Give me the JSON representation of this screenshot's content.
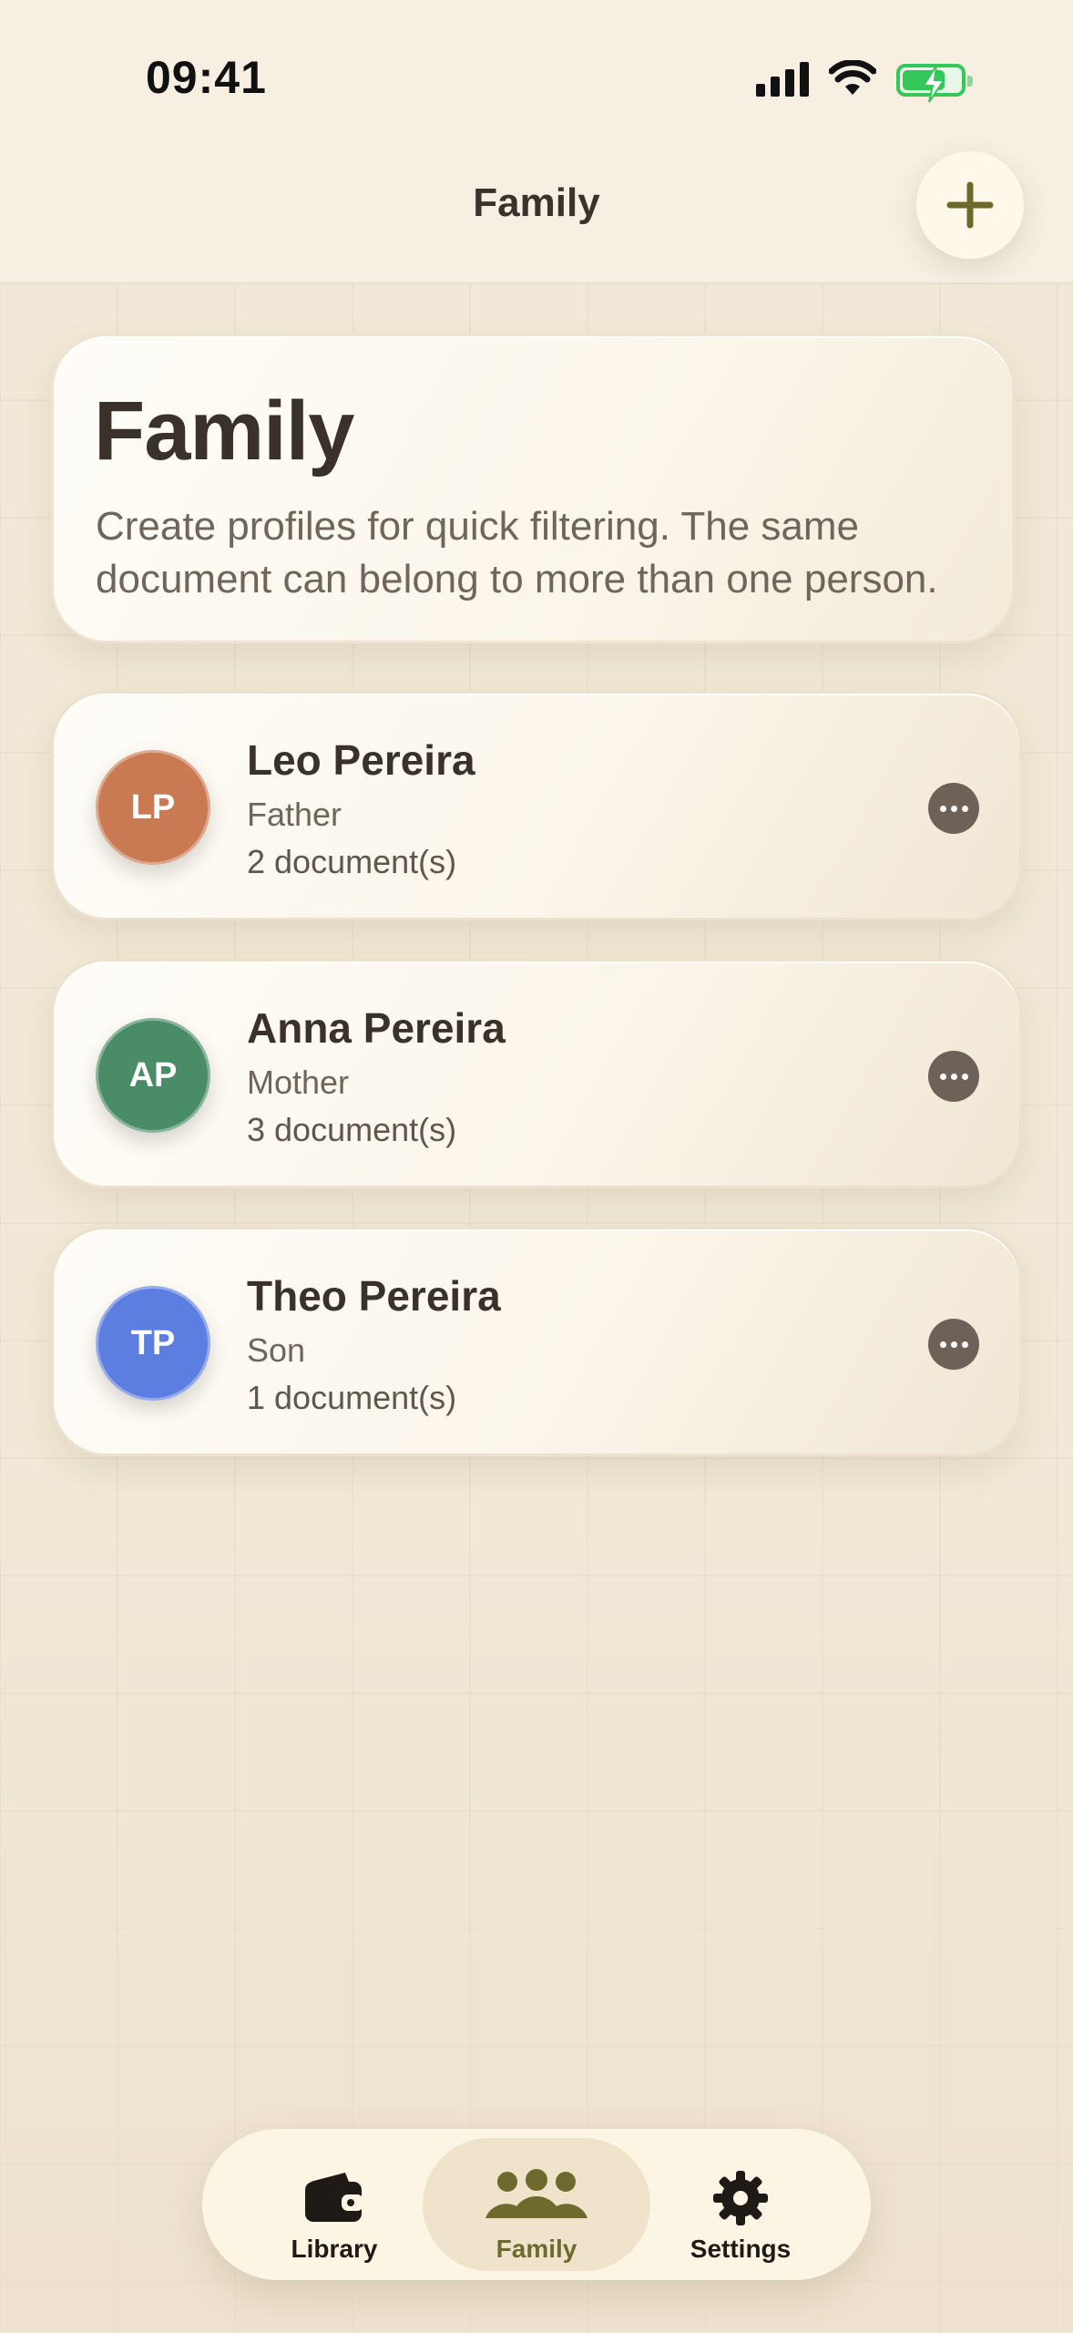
{
  "status_bar": {
    "time": "09:41"
  },
  "nav": {
    "title": "Family",
    "add_label": "+"
  },
  "intro": {
    "title": "Family",
    "subtitle": "Create profiles for quick filtering. The same document can belong to more than one person."
  },
  "members": [
    {
      "initials": "LP",
      "name": "Leo Pereira",
      "role": "Father",
      "documents": "2 document(s)",
      "color": "#c97a52"
    },
    {
      "initials": "AP",
      "name": "Anna Pereira",
      "role": "Mother",
      "documents": "3 document(s)",
      "color": "#4a8c67"
    },
    {
      "initials": "TP",
      "name": "Theo Pereira",
      "role": "Son",
      "documents": "1 document(s)",
      "color": "#5c7ee0"
    }
  ],
  "tabs": [
    {
      "label": "Library",
      "icon": "wallet-icon",
      "active": false
    },
    {
      "label": "Family",
      "icon": "people-icon",
      "active": true
    },
    {
      "label": "Settings",
      "icon": "gear-icon",
      "active": false
    }
  ],
  "colors": {
    "accent": "#6e6a2e",
    "battery": "#34c759"
  }
}
